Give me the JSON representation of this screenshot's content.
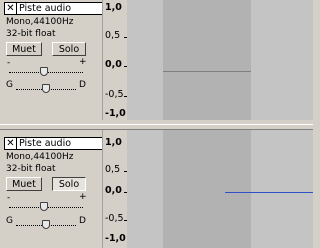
{
  "tracks": [
    {
      "name": "Piste audio",
      "format": "Mono,44100Hz",
      "bitdepth": "32-bit float",
      "mute_label": "Muet",
      "solo_label": "Solo",
      "solo_pressed": false,
      "gain_minus": "-",
      "gain_plus": "+",
      "pan_left": "G",
      "pan_right": "D",
      "ruler": [
        "1,0",
        "0,5",
        "0,0",
        "-0,5",
        "-1,0"
      ],
      "waveform_color": "#808080"
    },
    {
      "name": "Piste audio",
      "format": "Mono,44100Hz",
      "bitdepth": "32-bit float",
      "mute_label": "Muet",
      "solo_label": "Solo",
      "solo_pressed": true,
      "gain_minus": "-",
      "gain_plus": "+",
      "pan_left": "G",
      "pan_right": "D",
      "ruler": [
        "1,0",
        "0,5",
        "0,0",
        "-0,5",
        "-1,0"
      ],
      "waveform_color": "#3050c8"
    }
  ]
}
